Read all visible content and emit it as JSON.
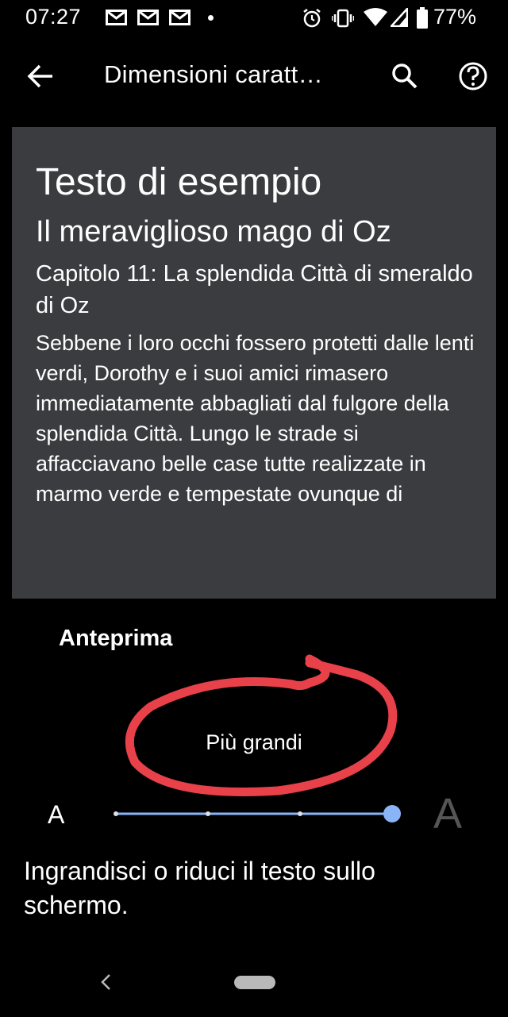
{
  "status_bar": {
    "time": "07:27",
    "battery_percent": "77%",
    "icons": [
      "gmail-icon",
      "gmail-icon",
      "gmail-icon",
      "notification-dot",
      "alarm-icon",
      "vibrate-icon",
      "wifi-icon",
      "signal-icon",
      "battery-icon"
    ]
  },
  "app_bar": {
    "title": "Dimensioni caratt…",
    "back_icon": "arrow-back-icon",
    "search_icon": "search-icon",
    "help_icon": "help-icon"
  },
  "preview": {
    "heading": "Testo di esempio",
    "title": "Il meraviglioso mago di Oz",
    "chapter": "Capitolo 11: La splendida Città di smeraldo di Oz",
    "body": "Sebbene i loro occhi fossero protetti dalle lenti verdi, Dorothy e i suoi amici rimasero immediatamente abbagliati dal fulgore della splendida Città. Lungo le strade si affacciavano belle case tutte realizzate in marmo verde e tempestate ovunque di",
    "label": "Anteprima"
  },
  "font_size": {
    "current_label": "Più grandi",
    "small_glyph": "A",
    "large_glyph": "A",
    "steps": 4,
    "selected_step": 4
  },
  "description": "Ingrandisci o riduci il testo sullo schermo.",
  "colors": {
    "card_background": "#3a3c3f",
    "slider_accent": "#8ab4f8",
    "annotation": "#e8414a"
  }
}
